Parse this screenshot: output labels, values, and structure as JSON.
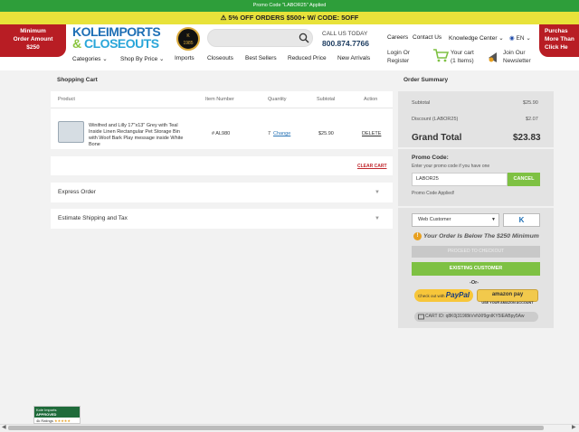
{
  "top_notice": "Promo Code \"LABOR25\" Applied",
  "promo_strip": "5% OFF ORDERS $500+ W/ CODE: 5OFF",
  "min_order": {
    "line1": "Minimum",
    "line2": "Order Amount",
    "line3": "$250"
  },
  "purchase_badge": {
    "line1": "Purchas",
    "line2": "More Than",
    "line3": "Click He"
  },
  "logo": {
    "line1": "KOLEIMPORTS",
    "amp": "&",
    "line2": "CLOSEOUTS"
  },
  "seal": {
    "top": "K",
    "year": "1985"
  },
  "search": {
    "placeholder": ""
  },
  "header": {
    "call_label": "CALL US TODAY",
    "phone": "800.874.7766",
    "careers": "Careers",
    "contact": "Contact Us",
    "knowledge": "Knowledge Center",
    "lang": "EN",
    "login_l1": "Login Or",
    "login_l2": "Register",
    "cart_l1": "Your cart",
    "cart_l2": "(1 Items)",
    "join_l1": "Join Our",
    "join_l2": "Newsletter"
  },
  "nav": {
    "categories": "Categories",
    "shop_by_price": "Shop By Price",
    "imports": "Imports",
    "closeouts": "Closeouts",
    "best_sellers": "Best Sellers",
    "reduced_price": "Reduced Price",
    "new_arrivals": "New Arrivals"
  },
  "cart": {
    "title": "Shopping Cart",
    "columns": [
      "Product",
      "Item Number",
      "Quantity",
      "Subtotal",
      "Action"
    ],
    "item": {
      "name": "Winifred and Lilly 17\"x13\" Grey with Teal Inside Linen Rectangular Pet Storage Bin with Woof Bark Play message inside White Bone",
      "sku": "# AL980",
      "qty": "7",
      "change": "Change",
      "subtotal": "$25.90",
      "delete": "DELETE"
    },
    "clear": "CLEAR CART",
    "express": "Express Order",
    "estimate": "Estimate Shipping and Tax"
  },
  "summary": {
    "title": "Order Summary",
    "subtotal_label": "Subtotal",
    "subtotal_value": "$25.90",
    "discount_label": "Discount (LABOR25)",
    "discount_value": "$2.07",
    "grand_label": "Grand Total",
    "grand_value": "$23.83"
  },
  "promo": {
    "label": "Promo Code:",
    "hint": "Enter your promo code if you have one",
    "value": "LABOR25",
    "cancel": "CANCEL",
    "applied": "Promo Code Applied!"
  },
  "checkout": {
    "customer_type": "Web Customer",
    "k_label": "K",
    "warning": "Your Order Is Below The $250 Minimum",
    "proceed": "PROCEED TO CHECKOUT",
    "existing": "EXISTING CUSTOMER",
    "or": "-Or-",
    "paypal_pre": "Check out with",
    "paypal": "PayPal",
    "amazon": "amazon pay",
    "amazon_sub": "USE YOUR AMAZON ACCOUNT",
    "cart_id": "CART ID: q8K0j319I8kVvNXf9gnlKY5lEABpy5Aw"
  },
  "trust": {
    "l1": "Kole Imports",
    "l2": "APPROVED",
    "l3": "4k Ratings"
  },
  "colors": {
    "green": "#7ec143",
    "red": "#b81d24",
    "yellow": "#e8e23a",
    "blue": "#1e6fb5"
  }
}
